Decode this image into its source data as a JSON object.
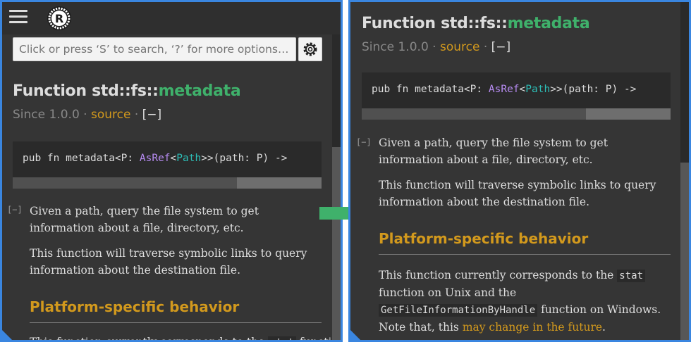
{
  "colors": {
    "background": "#353535",
    "accent_green": "#3fb16b",
    "link_gold": "#d2991d",
    "frame_blue": "#3a86e0",
    "transition_arrow": "#3fb16b"
  },
  "icons": {
    "menu": "hamburger-icon",
    "logo": "rust-logo",
    "settings": "gear-icon",
    "transition": "right-arrow-icon"
  },
  "left": {
    "search": {
      "placeholder": "Click or press ‘S’ to search, ‘?’ for more options…"
    },
    "title": {
      "prefix": "Function std::fs::",
      "name": "metadata"
    },
    "since": {
      "label": "Since 1.0.0",
      "sep1": " · ",
      "source": "source",
      "sep2": " · ",
      "toggle": "[−]"
    },
    "signature": {
      "p1": "pub fn metadata<P: ",
      "trait": "AsRef",
      "lt": "<",
      "struct": "Path",
      "p2": ">>(path: P) ->"
    },
    "collapse": "[−]",
    "para1": "Given a path, query the file system to get information about a file, directory, etc.",
    "para2": "This function will traverse symbolic links to query information about the destination file.",
    "heading": "Platform-specific behavior",
    "para3": {
      "t1": "This function currently corresponds to the ",
      "code": "stat",
      "t2": " function"
    }
  },
  "right": {
    "title": {
      "prefix": "Function std::fs::",
      "name": "metadata"
    },
    "since": {
      "label": "Since 1.0.0",
      "sep1": " · ",
      "source": "source",
      "sep2": " · ",
      "toggle": "[−]"
    },
    "signature": {
      "p1": "pub fn metadata<P: ",
      "trait": "AsRef",
      "lt": "<",
      "struct": "Path",
      "p2": ">>(path: P) ->"
    },
    "collapse": "[−]",
    "para1": "Given a path, query the file system to get information about a file, directory, etc.",
    "para2": "This function will traverse symbolic links to query information about the destination file.",
    "heading": "Platform-specific behavior",
    "para3": {
      "t1": "This function currently corresponds to the ",
      "code1": "stat",
      "t2": " function on Unix and the ",
      "code2": "GetFileInformationByHandle",
      "t3": " function on Windows. Note that, this ",
      "link": "may change in the future",
      "t4": "."
    }
  }
}
